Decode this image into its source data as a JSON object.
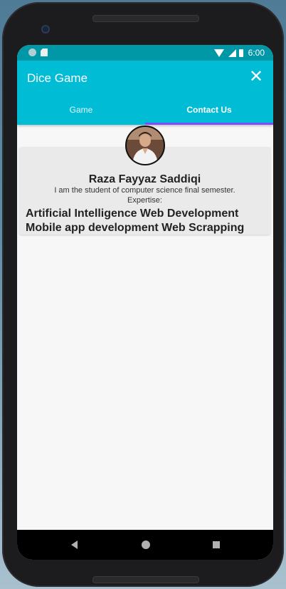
{
  "statusbar": {
    "time": "6:00"
  },
  "appbar": {
    "title": "Dice Game",
    "close_glyph": "✕"
  },
  "tabs": [
    {
      "label": "Game",
      "selected": false
    },
    {
      "label": "Contact Us",
      "selected": true
    }
  ],
  "profile": {
    "name": "Raza Fayyaz Saddiqi",
    "bio": "I am the student of computer science final semester.",
    "expertise_label": "Expertise:",
    "expertise_lines": [
      "Artificial Intelligence Web Development",
      "Mobile app development Web Scrapping"
    ]
  },
  "colors": {
    "appbar": "#00bcd4",
    "statusbar": "#0097a7",
    "tab_indicator": "#7c4dff",
    "card": "#eaeaea"
  },
  "icons": {
    "close": "close-icon",
    "wifi": "wifi-icon",
    "signal": "signal-icon",
    "battery": "battery-icon",
    "back": "nav-back-icon",
    "home": "nav-home-icon",
    "recents": "nav-recents-icon"
  }
}
